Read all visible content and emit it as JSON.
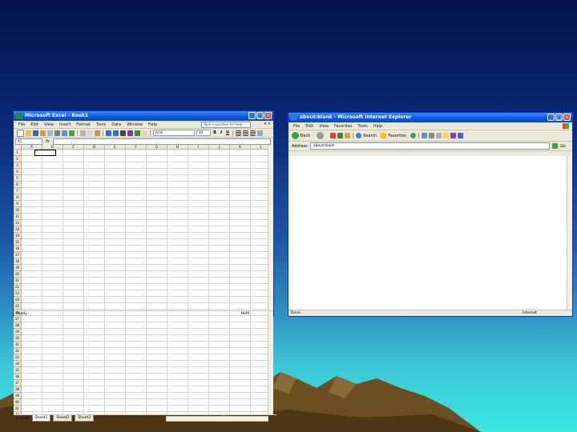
{
  "excel": {
    "title": "Microsoft Excel - Book1",
    "menu": [
      "File",
      "Edit",
      "View",
      "Insert",
      "Format",
      "Tools",
      "Data",
      "Window",
      "Help"
    ],
    "ask_placeholder": "Type a question for help",
    "menu_close": "▾ ✕",
    "font_name": "Arial",
    "font_size": "10",
    "bold": "B",
    "italic": "I",
    "underline": "U",
    "name_box": "A1",
    "fx": "fx",
    "columns": [
      "A",
      "B",
      "C",
      "D",
      "E",
      "F",
      "G",
      "H",
      "I",
      "J",
      "K",
      "L"
    ],
    "rows": [
      "1",
      "2",
      "3",
      "4",
      "5",
      "6",
      "7",
      "8",
      "9",
      "10",
      "11",
      "12",
      "13",
      "14",
      "15",
      "16",
      "17",
      "18",
      "19",
      "20",
      "21",
      "22",
      "23",
      "24",
      "25",
      "26",
      "27",
      "28",
      "29",
      "30",
      "31",
      "32",
      "33",
      "34",
      "35",
      "36",
      "37",
      "38",
      "39",
      "40",
      "41",
      "42"
    ],
    "tab_nav": "◂ ◂ ▸ ▸|",
    "sheets": [
      "Sheet1",
      "Sheet2",
      "Sheet3"
    ],
    "status_left": "Ready",
    "status_right": "NUM"
  },
  "ie": {
    "title": "about:blank - Microsoft Internet Explorer",
    "menu": [
      "File",
      "Edit",
      "View",
      "Favorites",
      "Tools",
      "Help"
    ],
    "back": "Back",
    "search": "Search",
    "favorites": "Favorites",
    "address_label": "Address",
    "address_value": "about:blank",
    "go": "Go",
    "status_left": "Done",
    "status_right": "Internet"
  },
  "colors": {
    "titlebar": "#0a58e0",
    "window_face": "#ece9d8",
    "close_button": "#d8432a"
  }
}
